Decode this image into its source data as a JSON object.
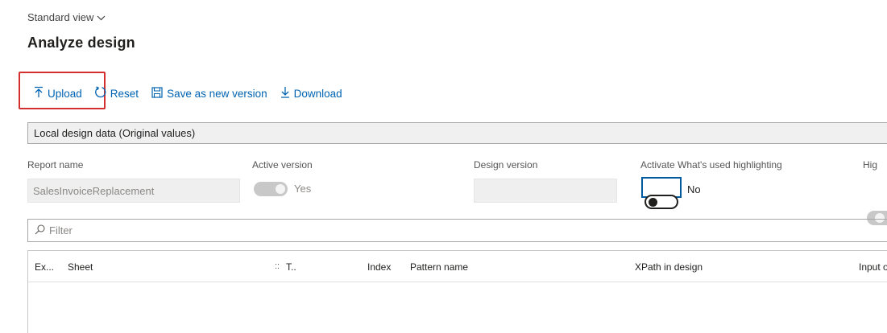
{
  "view": {
    "label": "Standard view"
  },
  "page": {
    "title": "Analyze design"
  },
  "toolbar": {
    "upload": "Upload",
    "reset": "Reset",
    "save_new_version": "Save as new version",
    "download": "Download"
  },
  "section": {
    "title": "Local design data (Original values)"
  },
  "fields": {
    "report_name": {
      "label": "Report name",
      "value": "SalesInvoiceReplacement"
    },
    "active_version": {
      "label": "Active version",
      "value": "Yes"
    },
    "design_version": {
      "label": "Design version",
      "value": ""
    },
    "whats_used": {
      "label": "Activate What's used highlighting",
      "value": "No"
    },
    "highlight": {
      "label": "Hig"
    }
  },
  "filter": {
    "placeholder": "Filter"
  },
  "grid": {
    "columns": {
      "ex": "Ex...",
      "sheet": "Sheet",
      "type": "T..",
      "index": "Index",
      "pattern_name": "Pattern name",
      "xpath": "XPath in design",
      "input": "Input ob"
    },
    "rows": []
  },
  "colors": {
    "accent": "#0063b1",
    "highlight_box": "#d32f2f"
  }
}
